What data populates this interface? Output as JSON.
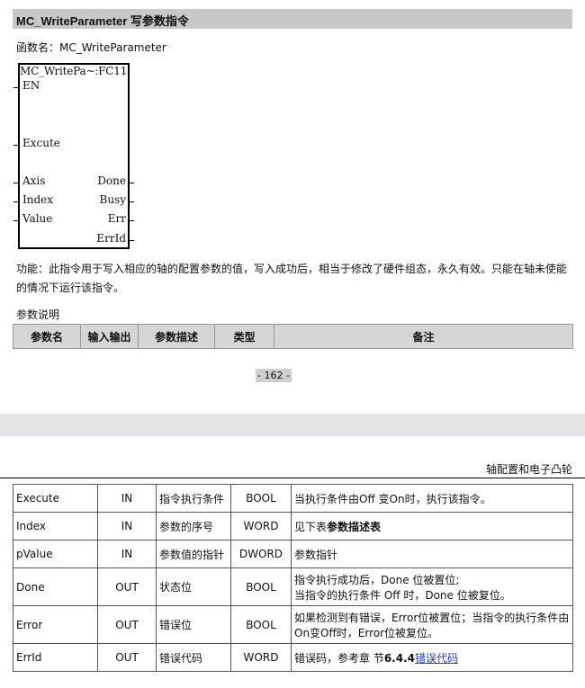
{
  "page1": {
    "title": "MC_WriteParameter 写参数指令",
    "function_name": "函数名：MC_WriteParameter",
    "block": {
      "name": "MC_WritePa~:FC11",
      "inputs": [
        "EN",
        "Excute",
        "Axis",
        "Index",
        "Value"
      ],
      "outputs": [
        "Done",
        "Busy",
        "Err",
        "ErrId"
      ]
    },
    "description": "功能：此指令用于写入相应的轴的配置参数的值，写入成功后，相当于修改了硬件组态，永久有效。只能在轴未使能的情况下运行该指令。",
    "params_label": "参数说明",
    "table_headers": [
      "参数名",
      "输入输出",
      "参数描述",
      "类型",
      "备注"
    ],
    "page_number": "- 162 -"
  },
  "page2": {
    "chapter": "轴配置和电子凸轮",
    "rows": [
      {
        "name": "Execute",
        "io": "IN",
        "desc": "指令执行条件",
        "type": "BOOL",
        "note": "当执行条件由Off 变On时，执行该指令。"
      },
      {
        "name": "Index",
        "io": "IN",
        "desc": "参数的序号",
        "type": "WORD",
        "note_pre": "见下表",
        "note_bold": "参数描述表"
      },
      {
        "name": "pValue",
        "io": "IN",
        "desc": "参数值的指针",
        "type": "DWORD",
        "note": "参数指针"
      },
      {
        "name": "Done",
        "io": "OUT",
        "desc": "状态位",
        "type": "BOOL",
        "note_line1": "指令执行成功后，Done 位被置位;",
        "note_line2": "当指令的执行条件 Off 时，Done 位被复位。"
      },
      {
        "name": "Error",
        "io": "OUT",
        "desc": "错误位",
        "type": "BOOL",
        "note_line1": "如果检测到有错误，Error位被置位；当指令的执行条件由",
        "note_line2": "On变Off时，Error位被复位。"
      },
      {
        "name": "ErrId",
        "io": "OUT",
        "desc": "错误代码",
        "type": "WORD",
        "note_pre": "错误码，参考章 节",
        "note_bold": "6.4.4",
        "note_link": "错误代码"
      }
    ]
  }
}
